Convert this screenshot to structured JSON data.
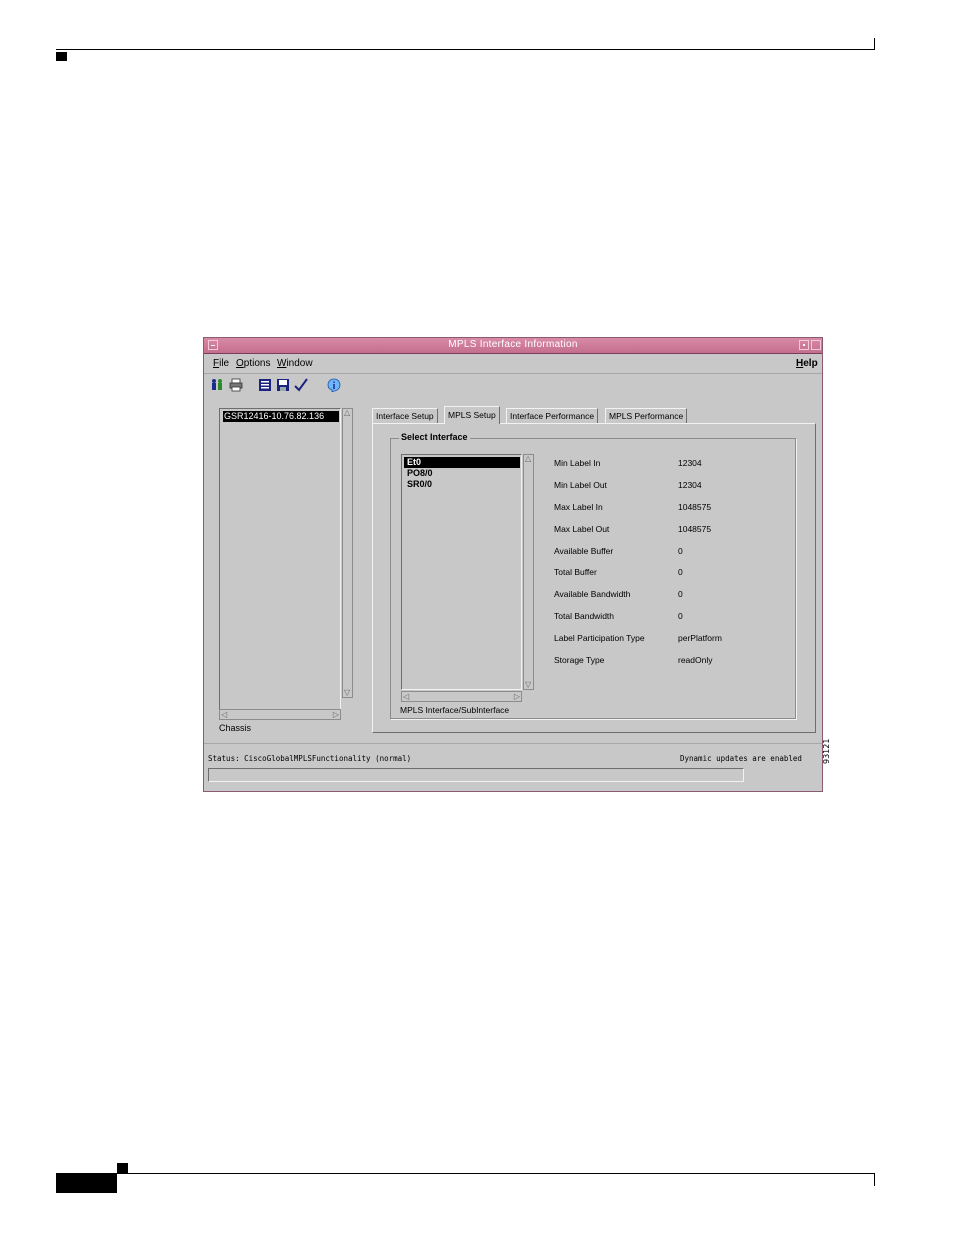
{
  "window": {
    "title": "MPLS Interface Information"
  },
  "menubar": {
    "file": {
      "underline": "F",
      "rest": "ile"
    },
    "options": {
      "underline": "O",
      "rest": "ptions"
    },
    "window": {
      "underline": "W",
      "rest": "indow"
    },
    "help": {
      "underline": "H",
      "rest": "elp"
    }
  },
  "toolbar": {
    "icons": [
      "people-icon",
      "printer-icon",
      "list-icon",
      "save-icon",
      "checkmark-icon",
      "info-icon"
    ]
  },
  "chassis": {
    "items": [
      "GSR12416-10.76.82.136"
    ],
    "caption": "Chassis"
  },
  "tabs": [
    "Interface Setup",
    "MPLS Setup",
    "Interface Performance",
    "MPLS Performance"
  ],
  "active_tab": "MPLS Setup",
  "select_interface": {
    "label": "Select Interface",
    "items": [
      "Et0",
      "PO8/0",
      "SR0/0"
    ],
    "selected": "Et0",
    "caption": "MPLS Interface/SubInterface"
  },
  "properties": [
    {
      "label": "Min Label In",
      "value": "12304"
    },
    {
      "label": "Min Label Out",
      "value": "12304"
    },
    {
      "label": "Max Label In",
      "value": "1048575"
    },
    {
      "label": "Max Label Out",
      "value": "1048575"
    },
    {
      "label": "Available Buffer",
      "value": "0"
    },
    {
      "label": "Total Buffer",
      "value": "0"
    },
    {
      "label": "Available Bandwidth",
      "value": "0"
    },
    {
      "label": "Total Bandwidth",
      "value": "0"
    },
    {
      "label": "Label Participation Type",
      "value": "perPlatform"
    },
    {
      "label": "Storage Type",
      "value": "readOnly"
    }
  ],
  "status": {
    "text": "Status: CiscoGlobalMPLSFunctionality (normal)",
    "dynamic": "Dynamic updates are enabled"
  },
  "figure_id": "93121"
}
